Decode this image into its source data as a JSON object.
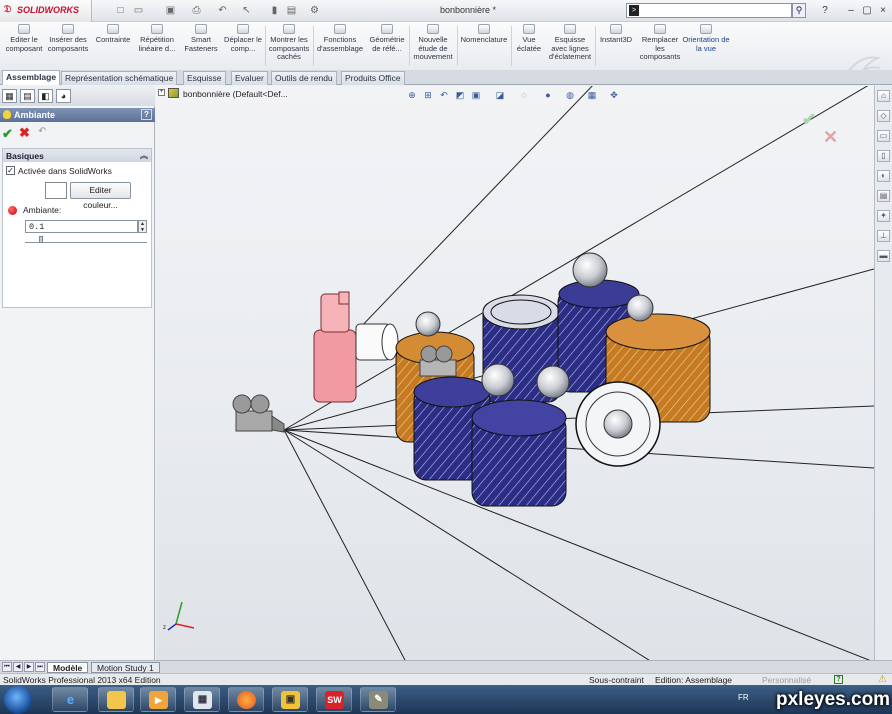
{
  "app": {
    "logo": "SOLIDWORKS",
    "document_title": "bonbonnière *",
    "search_placeholder": ""
  },
  "command_manager": {
    "items": [
      {
        "label": "Editer le composant",
        "name": "edit-component"
      },
      {
        "label": "Insérer des composants",
        "name": "insert-components"
      },
      {
        "label": "Contrainte",
        "name": "mate"
      },
      {
        "label": "Répétition linéaire d...",
        "name": "linear-pattern"
      },
      {
        "label": "Smart Fasteners",
        "name": "smart-fasteners"
      },
      {
        "label": "Déplacer le comp...",
        "name": "move-component"
      },
      {
        "label": "Montrer les composants cachés",
        "name": "show-hidden-components"
      },
      {
        "label": "Fonctions d'assemblage",
        "name": "assembly-features"
      },
      {
        "label": "Géométrie de réfé...",
        "name": "reference-geometry"
      },
      {
        "label": "Nouvelle étude de mouvement",
        "name": "new-motion-study"
      },
      {
        "label": "Nomenclature",
        "name": "bill-of-materials"
      },
      {
        "label": "Vue éclatée",
        "name": "exploded-view"
      },
      {
        "label": "Esquisse avec lignes d'éclatement",
        "name": "explode-line-sketch"
      },
      {
        "label": "Instant3D",
        "name": "instant3d"
      },
      {
        "label": "Remplacer les composants",
        "name": "replace-components"
      },
      {
        "label": "Orientation de la vue",
        "name": "view-orientation"
      }
    ]
  },
  "tabs": [
    "Assemblage",
    "Représentation schématique",
    "Esquisse",
    "Evaluer",
    "Outils de rendu",
    "Produits Office"
  ],
  "property_manager": {
    "title": "Ambiante",
    "help": "?",
    "group_title": "Basiques",
    "checkbox_label": "Activée dans SolidWorks",
    "checkbox_checked": true,
    "edit_color_button": "Editer couleur...",
    "ambient_label": "Ambiante:",
    "ambient_value": "0.1",
    "ambient_level": 0.1
  },
  "viewport": {
    "tree_root": "bonbonnière  (Default<Def..."
  },
  "bottom_tabs": [
    "Modèle",
    "Motion Study 1"
  ],
  "status": {
    "product": "SolidWorks Professional 2013 x64 Edition",
    "constraint": "Sous-contraint",
    "edition": "Edition: Assemblage",
    "custom": "Personnalisé"
  },
  "taskbar": {
    "language": "FR",
    "watermark": "pxleyes.com"
  },
  "colors": {
    "accent_blue": "#1d3f8f",
    "solidworks_red": "#c8102e",
    "glass_blue": "#2e2f8c",
    "amber": "#c9781a"
  }
}
